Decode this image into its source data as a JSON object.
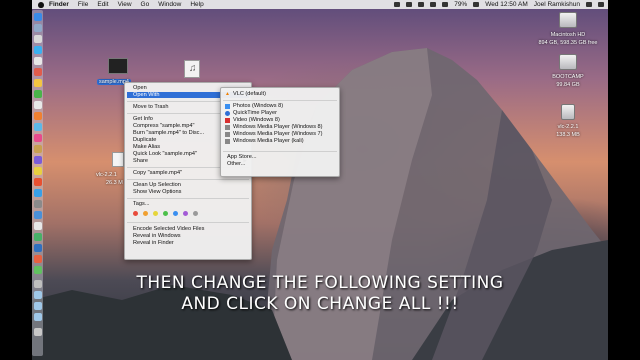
{
  "menubar": {
    "app": "Finder",
    "items": [
      "File",
      "Edit",
      "View",
      "Go",
      "Window",
      "Help"
    ],
    "battery": "79%",
    "clock": "Wed 12:50 AM",
    "user": "Joel Ramkishun"
  },
  "desktop": {
    "files": [
      {
        "label": "sample.mp4",
        "selected": true
      },
      {
        "label": "vlc-2.2.1"
      },
      {
        "label": "26.3 M"
      }
    ],
    "drives": [
      {
        "name": "Macintosh HD",
        "info": "894 GB, 598.35 GB free"
      },
      {
        "name": "BOOTCAMP",
        "info": "99.84 GB"
      },
      {
        "name": "vlc-2.2.1",
        "info": "138.3 MB"
      }
    ]
  },
  "context_menu": {
    "items": [
      "Open",
      "Open With",
      "Move to Trash",
      "Get Info",
      "Compress \"sample.mp4\"",
      "Burn \"sample.mp4\" to Disc...",
      "Duplicate",
      "Make Alias",
      "Quick Look \"sample.mp4\"",
      "Share",
      "Copy \"sample.mp4\"",
      "Clean Up Selection",
      "Show View Options",
      "Tags...",
      "Encode Selected Video Files",
      "Reveal in Windows",
      "Reveal in Finder"
    ],
    "tag_colors": [
      "#e84b3c",
      "#f0a030",
      "#e6d53a",
      "#4cc04a",
      "#3a8ff0",
      "#a35bd6",
      "#9a9a9a"
    ]
  },
  "open_with_menu": {
    "items": [
      "VLC (default)",
      "Photos (Windows 8)",
      "QuickTime Player",
      "Video (Windows 8)",
      "Windows Media Player (Windows 8)",
      "Windows Media Player (Windows 7)",
      "Windows Media Player (kali)",
      "App Store...",
      "Other..."
    ]
  },
  "caption": {
    "line1": "THEN CHANGE THE FOLLOWING SETTING",
    "line2": "AND CLICK ON CHANGE ALL !!!"
  }
}
